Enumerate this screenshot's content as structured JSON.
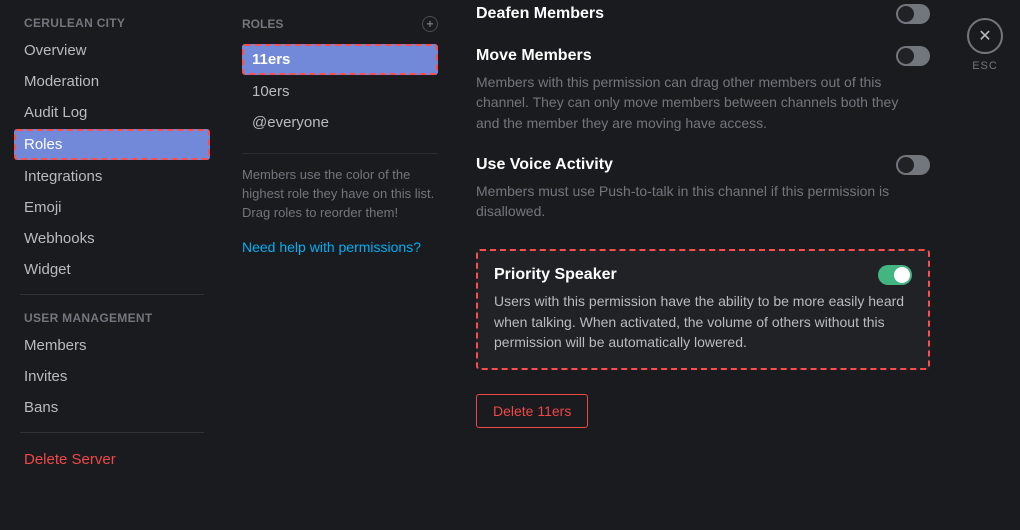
{
  "sidebar": {
    "server_header": "CERULEAN CITY",
    "items": [
      {
        "label": "Overview"
      },
      {
        "label": "Moderation"
      },
      {
        "label": "Audit Log"
      },
      {
        "label": "Roles"
      },
      {
        "label": "Integrations"
      },
      {
        "label": "Emoji"
      },
      {
        "label": "Webhooks"
      },
      {
        "label": "Widget"
      }
    ],
    "user_mgmt_header": "USER MANAGEMENT",
    "user_items": [
      {
        "label": "Members"
      },
      {
        "label": "Invites"
      },
      {
        "label": "Bans"
      }
    ],
    "delete_server": "Delete Server"
  },
  "roles": {
    "header": "ROLES",
    "items": [
      {
        "label": "11ers"
      },
      {
        "label": "10ers"
      },
      {
        "label": "@everyone"
      }
    ],
    "hint": "Members use the color of the highest role they have on this list. Drag roles to reorder them!",
    "help_link": "Need help with permissions?"
  },
  "permissions": [
    {
      "title": "Deafen Members",
      "desc": "",
      "on": false,
      "highlighted": false
    },
    {
      "title": "Move Members",
      "desc": "Members with this permission can drag other members out of this channel. They can only move members between channels both they and the member they are moving have access.",
      "on": false,
      "highlighted": false
    },
    {
      "title": "Use Voice Activity",
      "desc": "Members must use Push-to-talk in this channel if this permission is disallowed.",
      "on": false,
      "highlighted": false
    },
    {
      "title": "Priority Speaker",
      "desc": "Users with this permission have the ability to be more easily heard when talking. When activated, the volume of others without this permission will be automatically lowered.",
      "on": true,
      "highlighted": true
    }
  ],
  "delete_role_label": "Delete 11ers",
  "close": {
    "label": "ESC",
    "glyph": "✕"
  }
}
